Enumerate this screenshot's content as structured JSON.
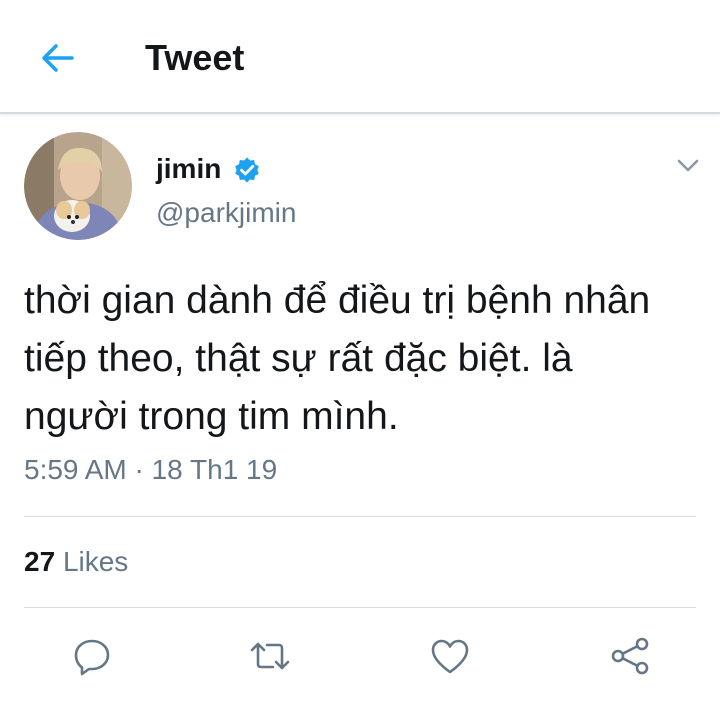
{
  "header": {
    "title": "Tweet",
    "back_icon": "arrow-left-icon",
    "accent_color": "#1da1f2"
  },
  "author": {
    "name": "jimin",
    "handle": "@parkjimin",
    "verified_icon": "verified-badge-icon"
  },
  "tweet": {
    "text": "thời gian dành để điều trị bệnh nhân tiếp theo, thật sự rất đặc biệt. là người trong tim mình.",
    "timestamp": "5:59 AM · 18 Th1 19"
  },
  "stats": {
    "likes_count": "27",
    "likes_label": "Likes"
  },
  "actions": [
    {
      "name": "reply",
      "icon": "reply-icon"
    },
    {
      "name": "retweet",
      "icon": "retweet-icon"
    },
    {
      "name": "like",
      "icon": "heart-icon"
    },
    {
      "name": "share",
      "icon": "share-icon"
    }
  ],
  "colors": {
    "text_primary": "#14171a",
    "text_secondary": "#657786",
    "icon_gray": "#657786"
  }
}
